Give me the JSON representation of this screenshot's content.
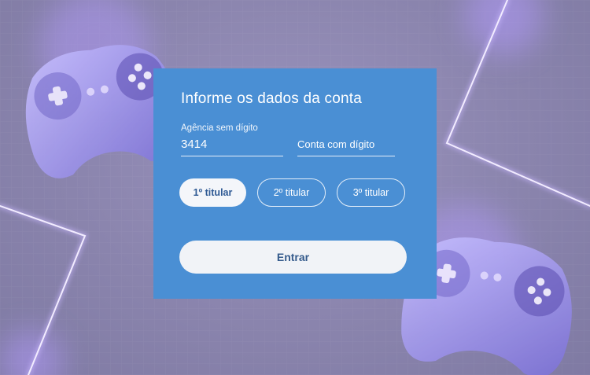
{
  "dialog": {
    "title": "Informe os dados da conta",
    "agencia": {
      "label": "Agência sem dígito",
      "value": "3414"
    },
    "conta": {
      "placeholder": "Conta com dígito"
    },
    "titulares": [
      {
        "label": "1º titular",
        "selected": true
      },
      {
        "label": "2º titular",
        "selected": false
      },
      {
        "label": "3º titular",
        "selected": false
      }
    ],
    "submit_label": "Entrar"
  },
  "colors": {
    "dialog_background": "#4a8fd4",
    "page_background": "#8a84ad",
    "neon_accent": "#b8a2ff",
    "button_text": "#355b8c"
  },
  "background": {
    "decorations": [
      "gamepad-illustration",
      "gamepad-illustration",
      "neon-line"
    ]
  }
}
